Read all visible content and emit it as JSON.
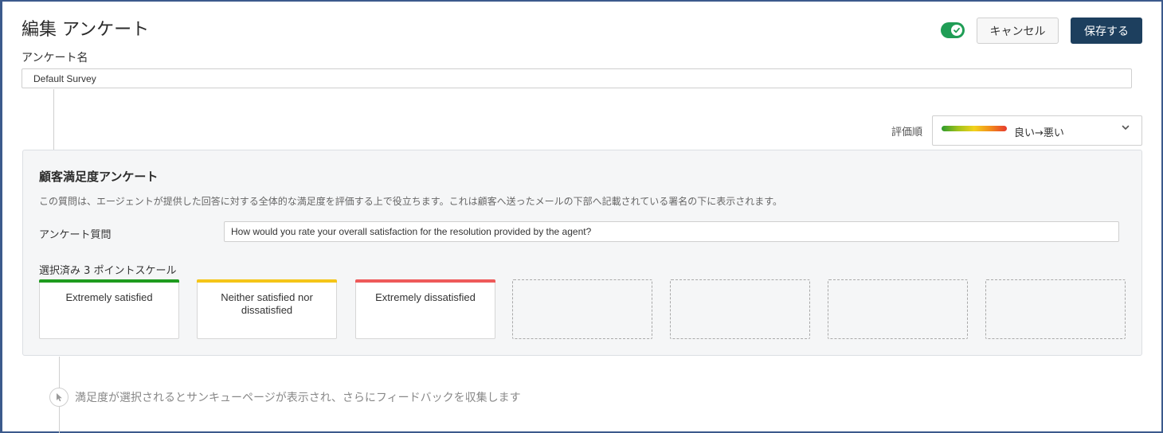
{
  "header": {
    "title": "編集 アンケート",
    "cancel_label": "キャンセル",
    "save_label": "保存する",
    "toggle_on": true
  },
  "survey_name": {
    "label": "アンケート名",
    "value": "Default Survey"
  },
  "rating_order": {
    "label": "評価順",
    "value": "良い→悪い",
    "icon": "chevron-down-icon"
  },
  "panel": {
    "title": "顧客満足度アンケート",
    "description": "この質問は、エージェントが提供した回答に対する全体的な満足度を評価する上で役立ちます。これは顧客へ送ったメールの下部へ記載されている署名の下に表示されます。",
    "question_label": "アンケート質問",
    "question_value": "How would you rate your overall satisfaction for the resolution provided by the agent?",
    "scale_label": "選択済み 3 ポイントスケール",
    "cards": [
      {
        "text": "Extremely satisfied",
        "color": "#1e9b1e"
      },
      {
        "text": "Neither satisfied nor dissatisfied",
        "color": "#f5c518"
      },
      {
        "text": "Extremely dissatisfied",
        "color": "#ee5a5a"
      },
      {
        "text": "",
        "color": ""
      },
      {
        "text": "",
        "color": ""
      },
      {
        "text": "",
        "color": ""
      },
      {
        "text": "",
        "color": ""
      }
    ]
  },
  "footer_note": {
    "icon": "pointer-click-icon",
    "text": "満足度が選択されるとサンキューページが表示され、さらにフィードバックを収集します"
  },
  "colors": {
    "accent": "#1d3f5e",
    "toggle": "#1f9d55",
    "frame": "#3b5a8c"
  }
}
